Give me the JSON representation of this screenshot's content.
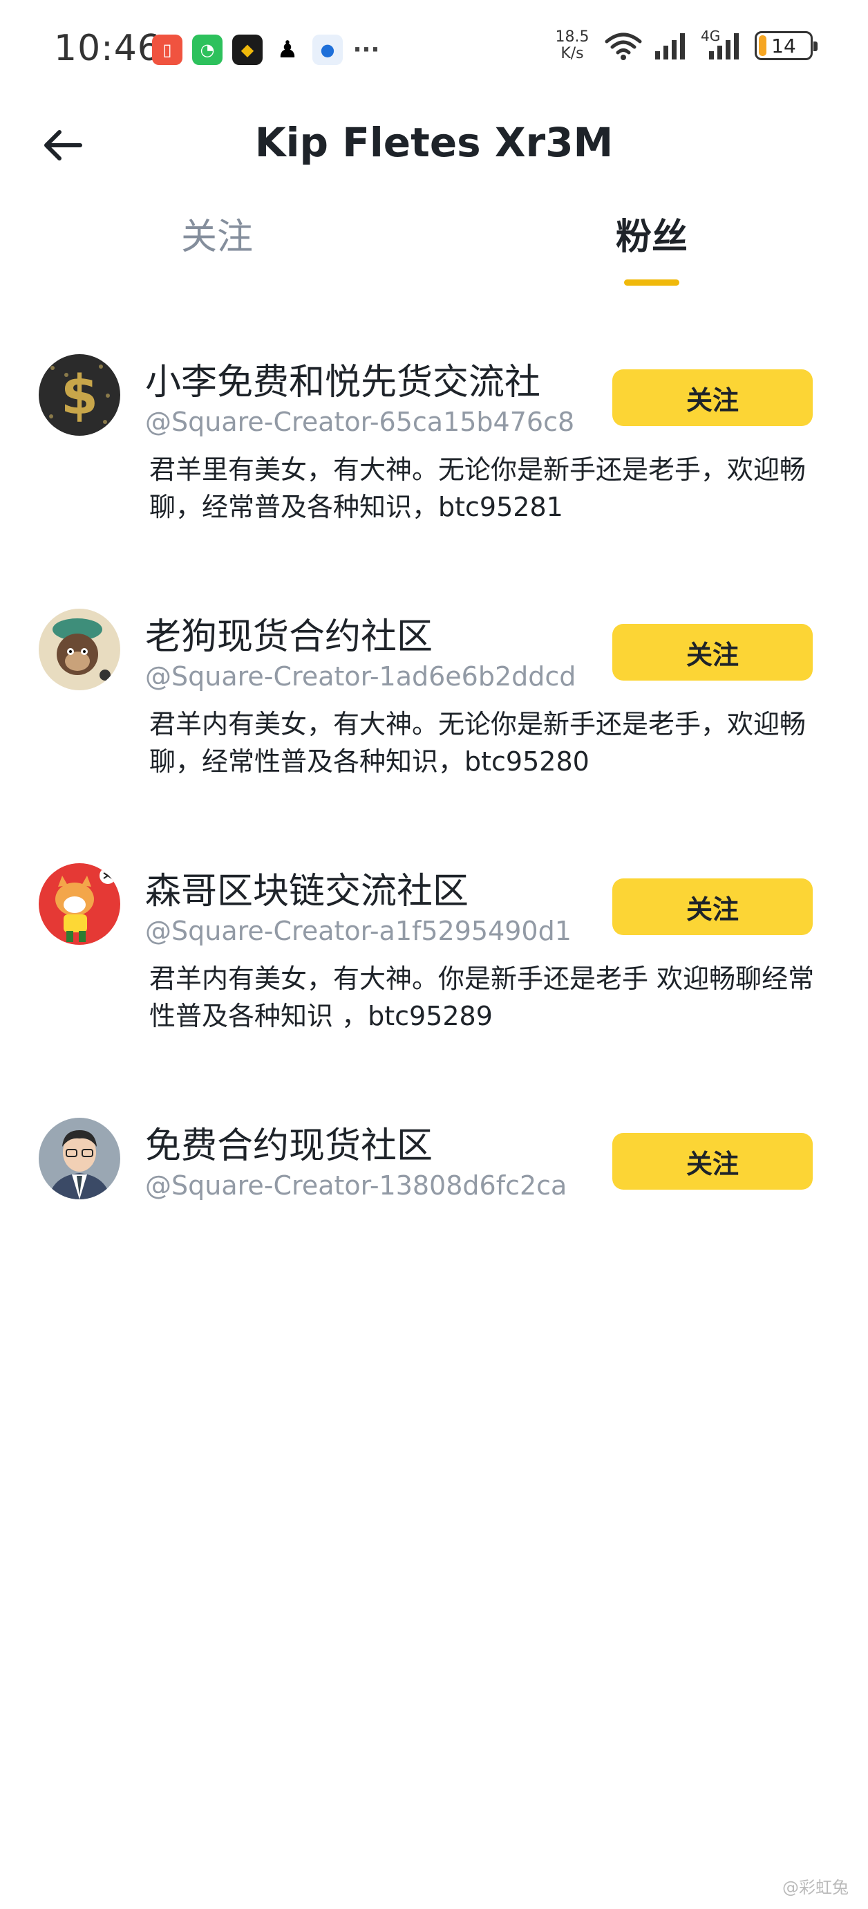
{
  "status_bar": {
    "time": "10:46",
    "net_speed_value": "18.5",
    "net_speed_unit": "K/s",
    "network_type": "4G",
    "battery_level": "14",
    "more_glyph": "···",
    "notification_icons": [
      "battery-app-icon",
      "wechat-icon",
      "binance-icon",
      "qq-icon",
      "app-store-icon"
    ]
  },
  "header": {
    "title": "Kip Fletes Xr3M"
  },
  "tabs": {
    "following": "关注",
    "fans": "粉丝",
    "active": "粉丝"
  },
  "fans": [
    {
      "name": "小李免费和悦先货交流社",
      "handle": "@Square-Creator-65ca15b476c8",
      "bio": "君羊里有美女，有大神。无论你是新手还是老手，欢迎畅聊，经常普及各种知识，btc95281",
      "follow_label": "关注",
      "avatar": "dollar-sign-avatar"
    },
    {
      "name": "老狗现货合约社区",
      "handle": "@Square-Creator-1ad6e6b2ddcd",
      "bio": "君羊内有美女，有大神。无论你是新手还是老手，欢迎畅聊，经常性普及各种知识，btc95280",
      "follow_label": "关注",
      "avatar": "monkey-avatar"
    },
    {
      "name": "森哥区块链交流社区",
      "handle": "@Square-Creator-a1f5295490d1",
      "bio": "君羊内有美女，有大神。你是新手还是老手 欢迎畅聊经常性普及各种知识 ，btc95289",
      "follow_label": "关注",
      "avatar": "shiba-dog-avatar"
    },
    {
      "name": "免费合约现货社区",
      "handle": "@Square-Creator-13808d6fc2ca",
      "bio": "",
      "follow_label": "关注",
      "avatar": "man-portrait-avatar"
    }
  ],
  "watermark": "@彩虹兔",
  "colors": {
    "accent": "#fcd535",
    "tab_underline": "#f0b90b",
    "text_primary": "#1e2329",
    "text_secondary": "#929aa5"
  }
}
